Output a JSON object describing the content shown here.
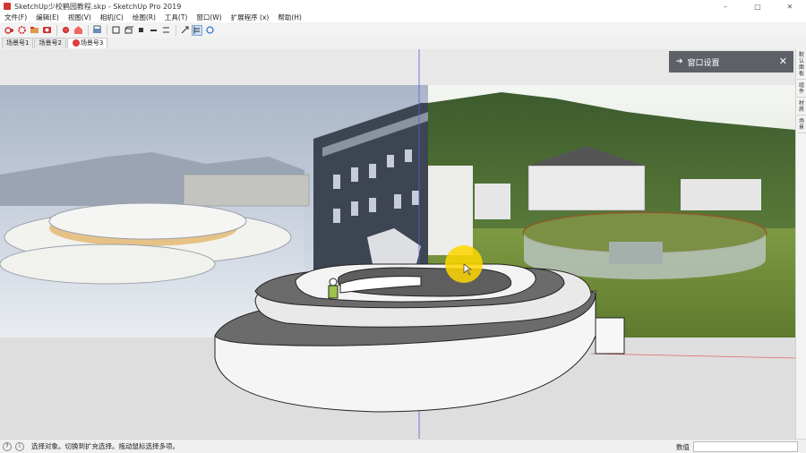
{
  "window": {
    "title": "SketchUp少校鹤园教程.skp - SketchUp Pro 2019",
    "minimize": "–",
    "maximize": "□",
    "close": "✕"
  },
  "menu": [
    "文件(F)",
    "编辑(E)",
    "视图(V)",
    "相机(C)",
    "绘图(R)",
    "工具(T)",
    "窗口(W)",
    "扩展程序 (x)",
    "帮助(H)"
  ],
  "scenes": {
    "tabs": [
      "场景号1",
      "场景号2",
      "场景号3"
    ]
  },
  "tray": {
    "title": "窗口设置",
    "close": "✕"
  },
  "right_panel": {
    "tabs": [
      "默认面板",
      "组件",
      "材质",
      "场景"
    ]
  },
  "status": {
    "message": "选择对象。切换到扩充选择。拖动鼠标选择多项。",
    "measurements_label": "数值",
    "measurements_value": ""
  },
  "colors": {
    "tray_bg": "#5d6167",
    "accent": "#d1352f",
    "cursor_highlight": "#ffd700"
  }
}
